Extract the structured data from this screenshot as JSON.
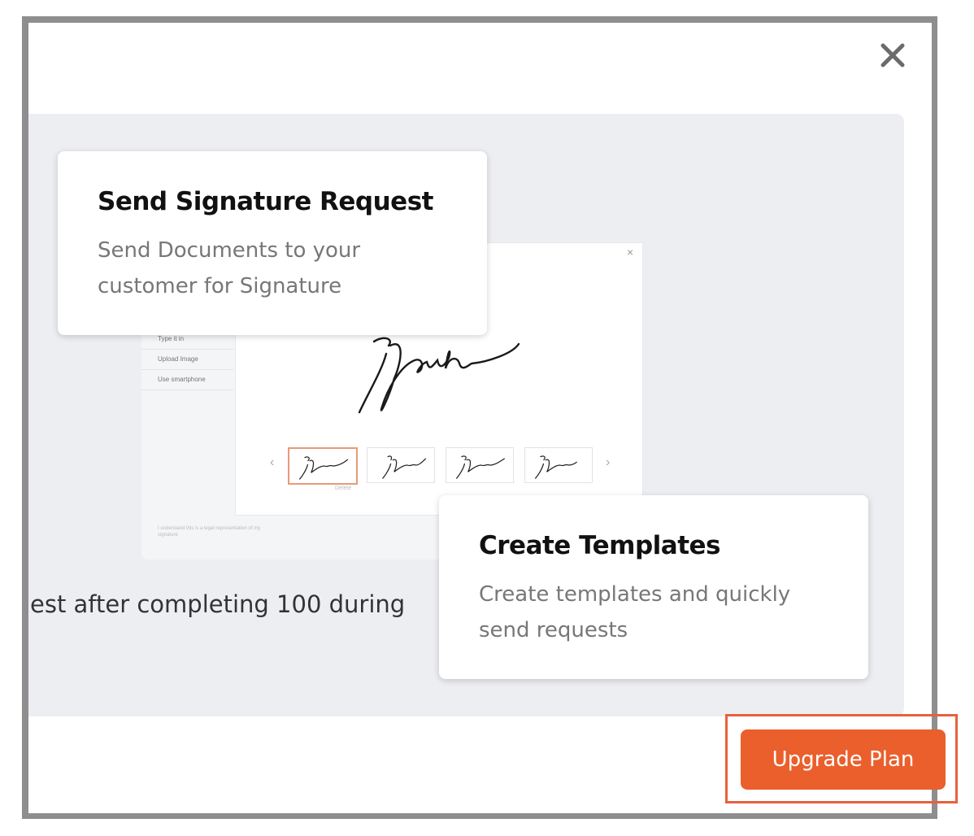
{
  "modal": {
    "close_icon": "close-icon",
    "background_text": "est after completing 100 during"
  },
  "cards": {
    "send": {
      "title": "Send Signature Request",
      "description": "Send Documents to your customer for Signature"
    },
    "templates": {
      "title": "Create Templates",
      "description": "Create templates and quickly send requests"
    }
  },
  "mockup": {
    "side_items": [
      "Type it in",
      "Upload Image",
      "Use smartphone"
    ],
    "close_glyph": "×",
    "prev_arrow": "‹",
    "next_arrow": "›",
    "delete_label": "Delete",
    "legal_text": "I understand this is a legal representation of my signature"
  },
  "footer": {
    "upgrade_label": "Upgrade Plan"
  },
  "colors": {
    "accent": "#ea5f2c",
    "panel": "#edeef2",
    "frame": "#8e8e8e"
  }
}
